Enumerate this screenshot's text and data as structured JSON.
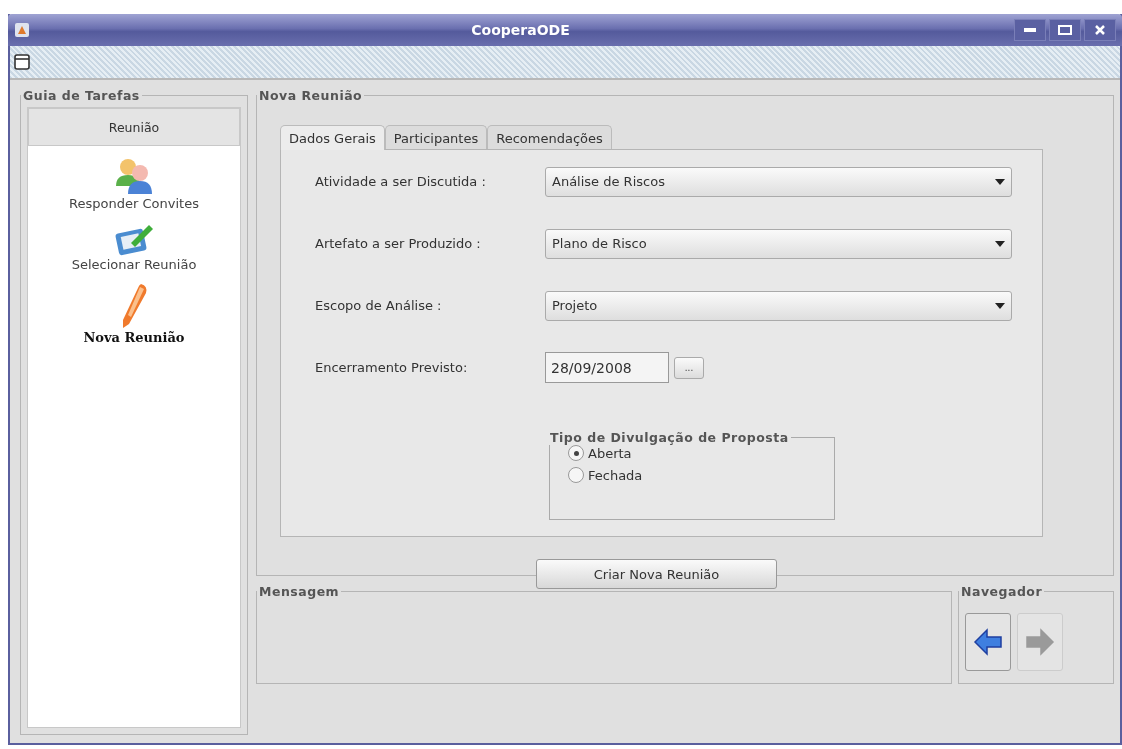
{
  "window": {
    "title": "CooperaODE"
  },
  "task_guide": {
    "title": "Guia de Tarefas",
    "section": "Reunião",
    "items": [
      {
        "kind": "people",
        "label": "Responder Convites",
        "selected": false
      },
      {
        "kind": "board",
        "label": "Selecionar Reunião",
        "selected": false
      },
      {
        "kind": "pen",
        "label": "Nova Reunião",
        "selected": true
      }
    ]
  },
  "main_panel": {
    "title": "Nova Reunião",
    "tabs": [
      {
        "label": "Dados Gerais",
        "selected": true
      },
      {
        "label": "Participantes",
        "selected": false
      },
      {
        "label": "Recomendações",
        "selected": false
      }
    ],
    "fields": [
      {
        "kind": "combo",
        "label": "Atividade a ser Discutida :",
        "value": "Análise de Riscos"
      },
      {
        "kind": "combo",
        "label": "Artefato a ser Produzido :",
        "value": "Plano de Risco"
      },
      {
        "kind": "combo",
        "label": "Escopo de Análise :",
        "value": "Projeto"
      },
      {
        "kind": "date",
        "label": "Encerramento Previsto:",
        "value": "28/09/2008",
        "button": "..."
      }
    ],
    "disclosure": {
      "title": "Tipo de Divulgação de Proposta",
      "options": [
        {
          "label": "Aberta",
          "selected": true
        },
        {
          "label": "Fechada",
          "selected": false
        }
      ]
    },
    "submit": "Criar Nova Reunião"
  },
  "message_panel": {
    "title": "Mensagem"
  },
  "navigator": {
    "title": "Navegador",
    "buttons": [
      {
        "kind": "back",
        "disabled": false
      },
      {
        "kind": "forward",
        "disabled": true
      }
    ]
  }
}
